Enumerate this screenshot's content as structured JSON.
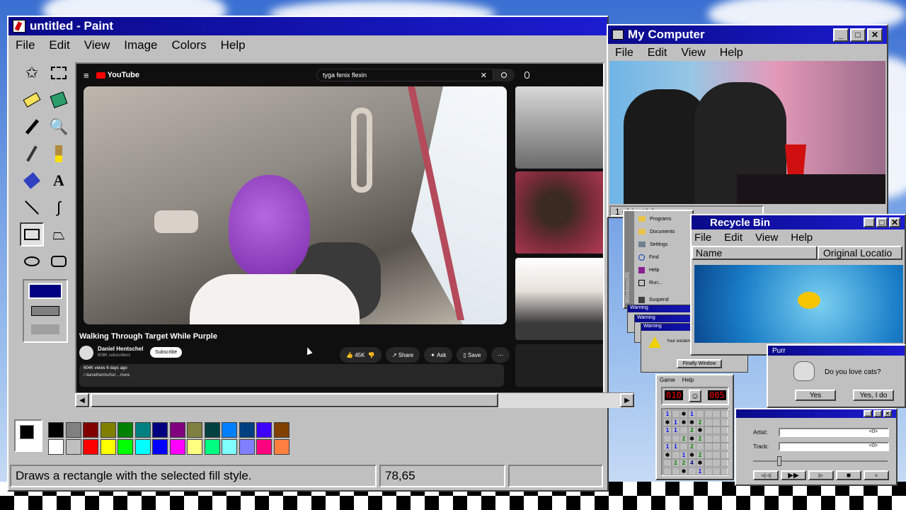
{
  "paint": {
    "title": "untitled - Paint",
    "menu": [
      "File",
      "Edit",
      "View",
      "Image",
      "Colors",
      "Help"
    ],
    "tools": [
      "free-select-icon",
      "rect-select-icon",
      "eraser-icon",
      "fill-icon",
      "picker-icon",
      "magnifier-icon",
      "pencil-icon",
      "brush-icon",
      "airbrush-icon",
      "text-icon",
      "line-icon",
      "curve-icon",
      "rectangle-icon",
      "polygon-icon",
      "ellipse-icon",
      "rounded-rect-icon"
    ],
    "palette_top": [
      "#000000",
      "#808080",
      "#800000",
      "#808000",
      "#008000",
      "#008080",
      "#000080",
      "#800080",
      "#808040",
      "#004040",
      "#0080ff",
      "#004080",
      "#4000ff",
      "#804000"
    ],
    "palette_bottom": [
      "#ffffff",
      "#c0c0c0",
      "#ff0000",
      "#ffff00",
      "#00ff00",
      "#00ffff",
      "#0000ff",
      "#ff00ff",
      "#ffff80",
      "#00ff80",
      "#80ffff",
      "#8080ff",
      "#ff0080",
      "#ff8040"
    ],
    "status_text": "Draws a rectangle with the selected fill style.",
    "coords": "78,65"
  },
  "youtube": {
    "logo": "YouTube",
    "search": "tyga fenix flexin",
    "video_title": "Walking Through Target While Purple",
    "channel": "Daniel Hentschel",
    "subscribers": "608K subscribers",
    "subscribe": "Subscribe",
    "likes": "45K",
    "share": "Share",
    "ask": "Ask",
    "save": "Save",
    "meta": "604K views  6 days ago",
    "desc": "/ danielhentschel  ...more"
  },
  "mycomputer": {
    "title": "My Computer",
    "menu": [
      "File",
      "Edit",
      "View",
      "Help"
    ],
    "status": "1 object(s)"
  },
  "recycle": {
    "title": "Recycle Bin",
    "menu": [
      "File",
      "Edit",
      "View",
      "Help"
    ],
    "col_name": "Name",
    "col_orig": "Original Locatio"
  },
  "purr": {
    "title": "Purr",
    "question": "Do you love cats?",
    "yes": "Yes",
    "yes2": "Yes, I do"
  },
  "startmenu": {
    "items": [
      "Programs",
      "Documents",
      "Settings",
      "Find",
      "Help",
      "Run...",
      "Suspend"
    ],
    "side": "Windows95"
  },
  "warning": {
    "title": "Warning",
    "message": "Your existence will now be ensured",
    "button": "Finally Window"
  },
  "minesweeper": {
    "menu": [
      "Game",
      "Help"
    ],
    "left_counter": "010",
    "right_counter": "005"
  },
  "player": {
    "artist_label": "Artist:",
    "track_label": "Track:",
    "artist_value": "<0>",
    "track_value": "<0>"
  },
  "colors": {
    "title_bar": "#0a0a8a",
    "face": "#c0c0c0",
    "yt_bg": "#0f0f0f"
  }
}
